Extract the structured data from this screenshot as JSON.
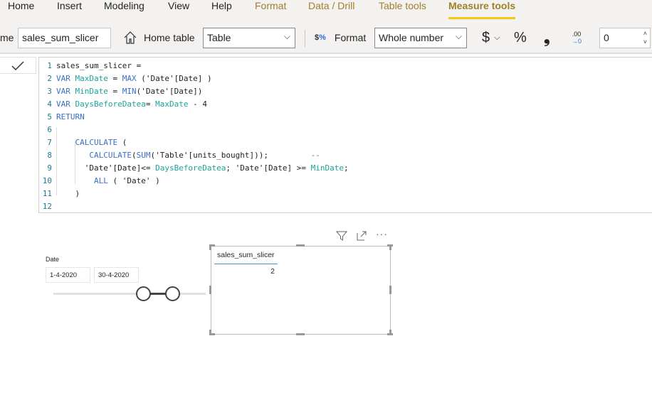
{
  "ribbon": {
    "tabs": [
      {
        "label": "Home",
        "kind": "normal"
      },
      {
        "label": "Insert",
        "kind": "normal"
      },
      {
        "label": "Modeling",
        "kind": "normal"
      },
      {
        "label": "View",
        "kind": "normal"
      },
      {
        "label": "Help",
        "kind": "normal"
      },
      {
        "label": "Format",
        "kind": "ctx"
      },
      {
        "label": "Data / Drill",
        "kind": "ctx"
      },
      {
        "label": "Table tools",
        "kind": "ctx"
      },
      {
        "label": "Measure tools",
        "kind": "active"
      }
    ],
    "name_label": "me",
    "name_value": "sales_sum_slicer",
    "home_table_label": "Home table",
    "home_table_value": "Table",
    "format_label": "Format",
    "format_value": "Whole number",
    "currency_symbol": "$",
    "percent_symbol": "%",
    "comma_symbol": "❟",
    "decimal_symbol": ".00",
    "decimals_value": "0"
  },
  "editor": {
    "lines": [
      [
        [
          "pl",
          "sales_sum_slicer ="
        ]
      ],
      [
        [
          "kw",
          "VAR "
        ],
        [
          "vr",
          "MaxDate"
        ],
        [
          "pl",
          " = "
        ],
        [
          "kw",
          "MAX"
        ],
        [
          "pl",
          " ('Date'[Date] )"
        ]
      ],
      [
        [
          "kw",
          "VAR "
        ],
        [
          "vr",
          "MinDate"
        ],
        [
          "pl",
          " = "
        ],
        [
          "kw",
          "MIN"
        ],
        [
          "pl",
          "('Date'[Date])"
        ]
      ],
      [
        [
          "kw",
          "VAR "
        ],
        [
          "vr",
          "DaysBeforeDatea"
        ],
        [
          "pl",
          "= "
        ],
        [
          "vr",
          "MaxDate"
        ],
        [
          "pl",
          " - 4"
        ]
      ],
      [
        [
          "kw",
          "RETURN"
        ]
      ],
      [
        [
          "pl",
          ""
        ]
      ],
      [
        [
          "pl",
          "    "
        ],
        [
          "kw",
          "CALCULATE"
        ],
        [
          "pl",
          " ("
        ]
      ],
      [
        [
          "pl",
          "       "
        ],
        [
          "kw",
          "CALCULATE"
        ],
        [
          "pl",
          "("
        ],
        [
          "kw",
          "SUM"
        ],
        [
          "pl",
          "('Table'[units_bought]));         "
        ],
        [
          "cm",
          "--"
        ]
      ],
      [
        [
          "pl",
          "      'Date'[Date]<= "
        ],
        [
          "vr",
          "DaysBeforeDatea"
        ],
        [
          "pl",
          "; 'Date'[Date] >= "
        ],
        [
          "vr",
          "MinDate"
        ],
        [
          "pl",
          ";"
        ]
      ],
      [
        [
          "pl",
          "        "
        ],
        [
          "kw",
          "ALL"
        ],
        [
          "pl",
          " ( 'Date' )"
        ]
      ],
      [
        [
          "pl",
          "    )"
        ]
      ],
      [
        [
          "pl",
          ""
        ]
      ]
    ]
  },
  "slicer": {
    "title": "Date",
    "start": "1-4-2020",
    "end": "30-4-2020"
  },
  "card": {
    "header": "sales_sum_slicer",
    "value": "2"
  },
  "colors": {
    "accent": "#f2c811",
    "keyword": "#3b6fc4",
    "variable": "#1ca39b",
    "comment": "#2f9b2f"
  }
}
